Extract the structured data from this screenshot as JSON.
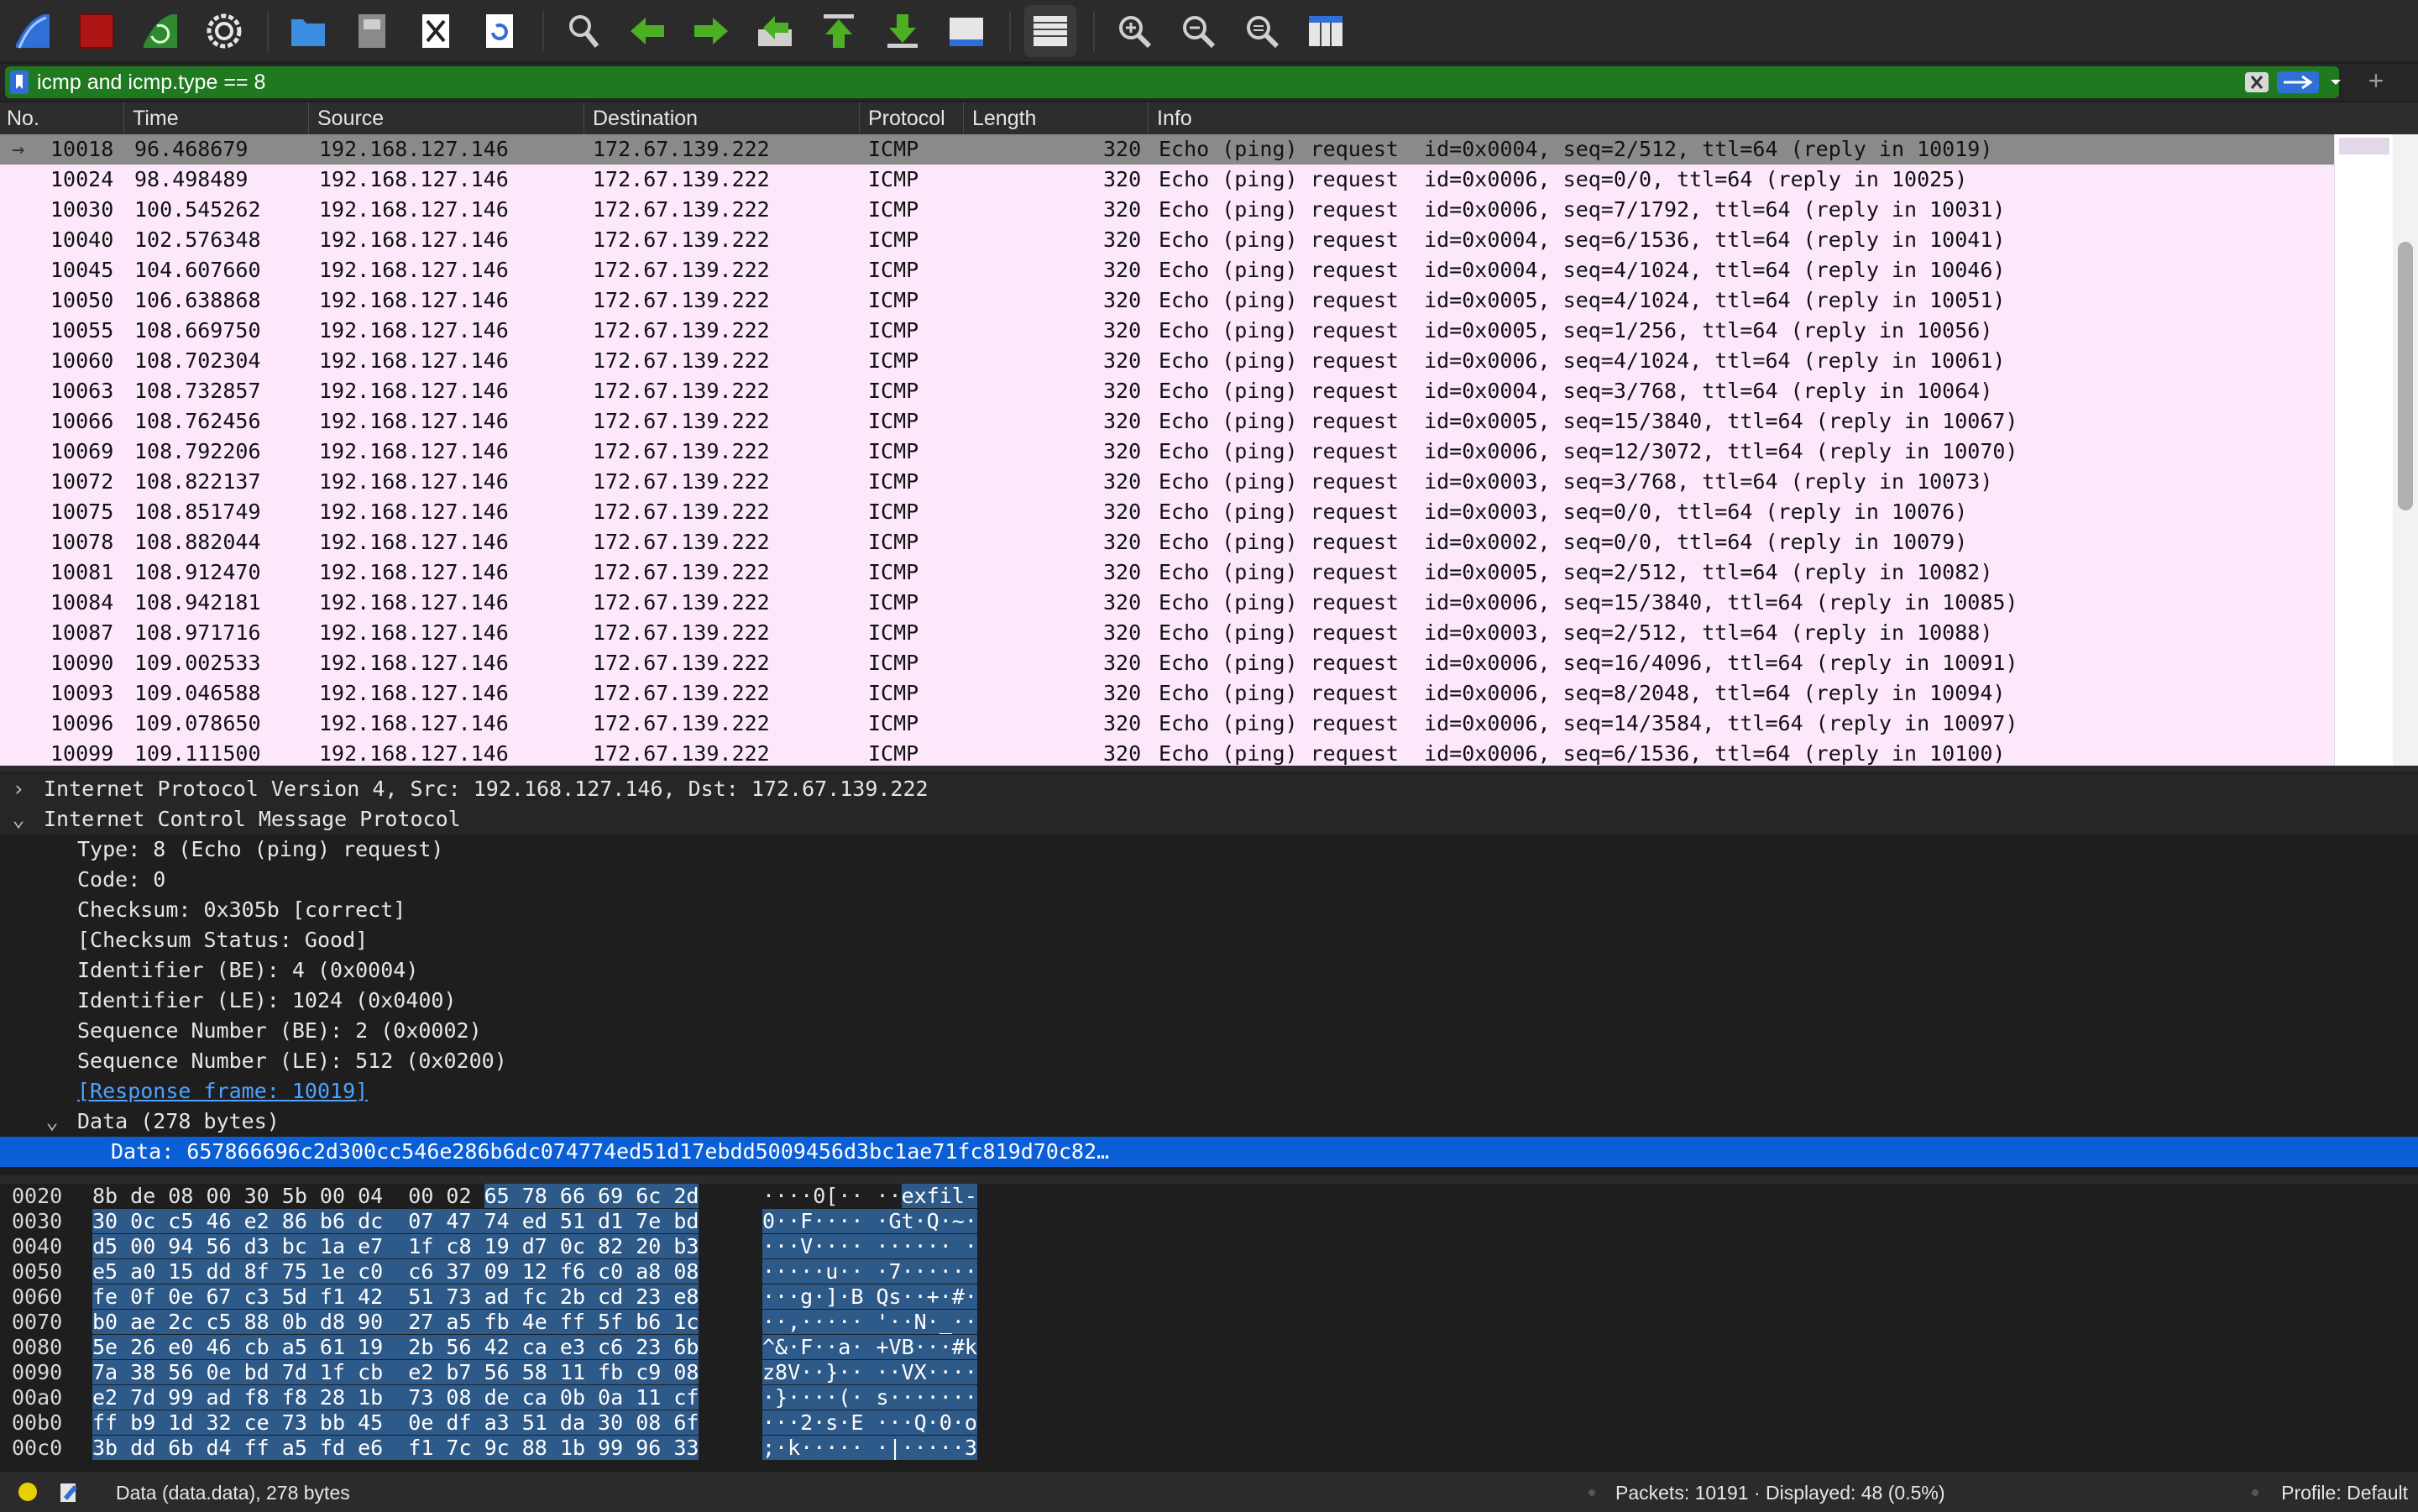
{
  "toolbar": {
    "buttons": [
      {
        "name": "start-capture-icon"
      },
      {
        "name": "stop-capture-icon"
      },
      {
        "name": "restart-capture-icon"
      },
      {
        "name": "capture-options-icon"
      },
      {
        "name": "open-file-icon"
      },
      {
        "name": "save-file-icon"
      },
      {
        "name": "close-file-icon"
      },
      {
        "name": "reload-file-icon"
      },
      {
        "name": "find-packet-icon"
      },
      {
        "name": "go-back-icon"
      },
      {
        "name": "go-forward-icon"
      },
      {
        "name": "go-to-packet-icon"
      },
      {
        "name": "go-first-packet-icon"
      },
      {
        "name": "go-last-packet-icon"
      },
      {
        "name": "autoscroll-icon"
      },
      {
        "name": "colorize-icon"
      },
      {
        "name": "zoom-in-icon"
      },
      {
        "name": "zoom-out-icon"
      },
      {
        "name": "normal-size-icon"
      },
      {
        "name": "resize-columns-icon"
      }
    ]
  },
  "filter": {
    "value": "icmp and icmp.type == 8",
    "color": "#1f7a1f"
  },
  "packet_list": {
    "columns": [
      "No.",
      "Time",
      "Source",
      "Destination",
      "Protocol",
      "Length",
      "Info"
    ],
    "row_color": "#fde8fb",
    "rows": [
      {
        "no": "10018",
        "time": "96.468679",
        "src": "192.168.127.146",
        "dst": "172.67.139.222",
        "proto": "ICMP",
        "len": "320",
        "info": "Echo (ping) request  id=0x0004, seq=2/512, ttl=64 (reply in 10019)",
        "selected": true
      },
      {
        "no": "10024",
        "time": "98.498489",
        "src": "192.168.127.146",
        "dst": "172.67.139.222",
        "proto": "ICMP",
        "len": "320",
        "info": "Echo (ping) request  id=0x0006, seq=0/0, ttl=64 (reply in 10025)"
      },
      {
        "no": "10030",
        "time": "100.545262",
        "src": "192.168.127.146",
        "dst": "172.67.139.222",
        "proto": "ICMP",
        "len": "320",
        "info": "Echo (ping) request  id=0x0006, seq=7/1792, ttl=64 (reply in 10031)"
      },
      {
        "no": "10040",
        "time": "102.576348",
        "src": "192.168.127.146",
        "dst": "172.67.139.222",
        "proto": "ICMP",
        "len": "320",
        "info": "Echo (ping) request  id=0x0004, seq=6/1536, ttl=64 (reply in 10041)"
      },
      {
        "no": "10045",
        "time": "104.607660",
        "src": "192.168.127.146",
        "dst": "172.67.139.222",
        "proto": "ICMP",
        "len": "320",
        "info": "Echo (ping) request  id=0x0004, seq=4/1024, ttl=64 (reply in 10046)"
      },
      {
        "no": "10050",
        "time": "106.638868",
        "src": "192.168.127.146",
        "dst": "172.67.139.222",
        "proto": "ICMP",
        "len": "320",
        "info": "Echo (ping) request  id=0x0005, seq=4/1024, ttl=64 (reply in 10051)"
      },
      {
        "no": "10055",
        "time": "108.669750",
        "src": "192.168.127.146",
        "dst": "172.67.139.222",
        "proto": "ICMP",
        "len": "320",
        "info": "Echo (ping) request  id=0x0005, seq=1/256, ttl=64 (reply in 10056)"
      },
      {
        "no": "10060",
        "time": "108.702304",
        "src": "192.168.127.146",
        "dst": "172.67.139.222",
        "proto": "ICMP",
        "len": "320",
        "info": "Echo (ping) request  id=0x0006, seq=4/1024, ttl=64 (reply in 10061)"
      },
      {
        "no": "10063",
        "time": "108.732857",
        "src": "192.168.127.146",
        "dst": "172.67.139.222",
        "proto": "ICMP",
        "len": "320",
        "info": "Echo (ping) request  id=0x0004, seq=3/768, ttl=64 (reply in 10064)"
      },
      {
        "no": "10066",
        "time": "108.762456",
        "src": "192.168.127.146",
        "dst": "172.67.139.222",
        "proto": "ICMP",
        "len": "320",
        "info": "Echo (ping) request  id=0x0005, seq=15/3840, ttl=64 (reply in 10067)"
      },
      {
        "no": "10069",
        "time": "108.792206",
        "src": "192.168.127.146",
        "dst": "172.67.139.222",
        "proto": "ICMP",
        "len": "320",
        "info": "Echo (ping) request  id=0x0006, seq=12/3072, ttl=64 (reply in 10070)"
      },
      {
        "no": "10072",
        "time": "108.822137",
        "src": "192.168.127.146",
        "dst": "172.67.139.222",
        "proto": "ICMP",
        "len": "320",
        "info": "Echo (ping) request  id=0x0003, seq=3/768, ttl=64 (reply in 10073)"
      },
      {
        "no": "10075",
        "time": "108.851749",
        "src": "192.168.127.146",
        "dst": "172.67.139.222",
        "proto": "ICMP",
        "len": "320",
        "info": "Echo (ping) request  id=0x0003, seq=0/0, ttl=64 (reply in 10076)"
      },
      {
        "no": "10078",
        "time": "108.882044",
        "src": "192.168.127.146",
        "dst": "172.67.139.222",
        "proto": "ICMP",
        "len": "320",
        "info": "Echo (ping) request  id=0x0002, seq=0/0, ttl=64 (reply in 10079)"
      },
      {
        "no": "10081",
        "time": "108.912470",
        "src": "192.168.127.146",
        "dst": "172.67.139.222",
        "proto": "ICMP",
        "len": "320",
        "info": "Echo (ping) request  id=0x0005, seq=2/512, ttl=64 (reply in 10082)"
      },
      {
        "no": "10084",
        "time": "108.942181",
        "src": "192.168.127.146",
        "dst": "172.67.139.222",
        "proto": "ICMP",
        "len": "320",
        "info": "Echo (ping) request  id=0x0006, seq=15/3840, ttl=64 (reply in 10085)"
      },
      {
        "no": "10087",
        "time": "108.971716",
        "src": "192.168.127.146",
        "dst": "172.67.139.222",
        "proto": "ICMP",
        "len": "320",
        "info": "Echo (ping) request  id=0x0003, seq=2/512, ttl=64 (reply in 10088)"
      },
      {
        "no": "10090",
        "time": "109.002533",
        "src": "192.168.127.146",
        "dst": "172.67.139.222",
        "proto": "ICMP",
        "len": "320",
        "info": "Echo (ping) request  id=0x0006, seq=16/4096, ttl=64 (reply in 10091)"
      },
      {
        "no": "10093",
        "time": "109.046588",
        "src": "192.168.127.146",
        "dst": "172.67.139.222",
        "proto": "ICMP",
        "len": "320",
        "info": "Echo (ping) request  id=0x0006, seq=8/2048, ttl=64 (reply in 10094)"
      },
      {
        "no": "10096",
        "time": "109.078650",
        "src": "192.168.127.146",
        "dst": "172.67.139.222",
        "proto": "ICMP",
        "len": "320",
        "info": "Echo (ping) request  id=0x0006, seq=14/3584, ttl=64 (reply in 10097)"
      },
      {
        "no": "10099",
        "time": "109.111500",
        "src": "192.168.127.146",
        "dst": "172.67.139.222",
        "proto": "ICMP",
        "len": "320",
        "info": "Echo (ping) request  id=0x0006, seq=6/1536, ttl=64 (reply in 10100)"
      }
    ]
  },
  "details": {
    "rows": [
      {
        "arrow": "›",
        "text": "Internet Protocol Version 4, Src: 192.168.127.146, Dst: 172.67.139.222",
        "indent": 0
      },
      {
        "arrow": "⌄",
        "text": "Internet Control Message Protocol",
        "indent": 0
      },
      {
        "arrow": "",
        "text": "Type: 8 (Echo (ping) request)",
        "indent": 1
      },
      {
        "arrow": "",
        "text": "Code: 0",
        "indent": 1
      },
      {
        "arrow": "",
        "text": "Checksum: 0x305b [correct]",
        "indent": 1
      },
      {
        "arrow": "",
        "text": "[Checksum Status: Good]",
        "indent": 1
      },
      {
        "arrow": "",
        "text": "Identifier (BE): 4 (0x0004)",
        "indent": 1
      },
      {
        "arrow": "",
        "text": "Identifier (LE): 1024 (0x0400)",
        "indent": 1
      },
      {
        "arrow": "",
        "text": "Sequence Number (BE): 2 (0x0002)",
        "indent": 1
      },
      {
        "arrow": "",
        "text": "Sequence Number (LE): 512 (0x0200)",
        "indent": 1
      },
      {
        "arrow": "",
        "text": "[Response frame: 10019]",
        "indent": 1,
        "link": true
      },
      {
        "arrow": "⌄",
        "text": "Data (278 bytes)",
        "indent": 1
      },
      {
        "arrow": "",
        "text": "Data: 657866696c2d300cc546e286b6dc074774ed51d17ebdd5009456d3bc1ae71fc819d70c82…",
        "indent": 2,
        "selected": true
      }
    ]
  },
  "hex": {
    "lines": [
      {
        "offset": "0020",
        "plain_bytes": "8b de 08 00 30 5b 00 04  00 02 ",
        "hl_bytes": "65 78 66 69 6c 2d",
        "plain_ascii": "····0[·· ··",
        "hl_ascii": "exfil-"
      },
      {
        "offset": "0030",
        "plain_bytes": "",
        "hl_bytes": "30 0c c5 46 e2 86 b6 dc  07 47 74 ed 51 d1 7e bd",
        "plain_ascii": "",
        "hl_ascii": "0··F···· ·Gt·Q·~·"
      },
      {
        "offset": "0040",
        "plain_bytes": "",
        "hl_bytes": "d5 00 94 56 d3 bc 1a e7  1f c8 19 d7 0c 82 20 b3",
        "plain_ascii": "",
        "hl_ascii": "···V···· ······ ·"
      },
      {
        "offset": "0050",
        "plain_bytes": "",
        "hl_bytes": "e5 a0 15 dd 8f 75 1e c0  c6 37 09 12 f6 c0 a8 08",
        "plain_ascii": "",
        "hl_ascii": "·····u·· ·7······"
      },
      {
        "offset": "0060",
        "plain_bytes": "",
        "hl_bytes": "fe 0f 0e 67 c3 5d f1 42  51 73 ad fc 2b cd 23 e8",
        "plain_ascii": "",
        "hl_ascii": "···g·]·B Qs··+·#·"
      },
      {
        "offset": "0070",
        "plain_bytes": "",
        "hl_bytes": "b0 ae 2c c5 88 0b d8 90  27 a5 fb 4e ff 5f b6 1c",
        "plain_ascii": "",
        "hl_ascii": "··,····· '··N·_··"
      },
      {
        "offset": "0080",
        "plain_bytes": "",
        "hl_bytes": "5e 26 e0 46 cb a5 61 19  2b 56 42 ca e3 c6 23 6b",
        "plain_ascii": "",
        "hl_ascii": "^&·F··a· +VB···#k"
      },
      {
        "offset": "0090",
        "plain_bytes": "",
        "hl_bytes": "7a 38 56 0e bd 7d 1f cb  e2 b7 56 58 11 fb c9 08",
        "plain_ascii": "",
        "hl_ascii": "z8V··}·· ··VX····"
      },
      {
        "offset": "00a0",
        "plain_bytes": "",
        "hl_bytes": "e2 7d 99 ad f8 f8 28 1b  73 08 de ca 0b 0a 11 cf",
        "plain_ascii": "",
        "hl_ascii": "·}····(· s·······"
      },
      {
        "offset": "00b0",
        "plain_bytes": "",
        "hl_bytes": "ff b9 1d 32 ce 73 bb 45  0e df a3 51 da 30 08 6f",
        "plain_ascii": "",
        "hl_ascii": "···2·s·E ···Q·0·o"
      },
      {
        "offset": "00c0",
        "plain_bytes": "",
        "hl_bytes": "3b dd 6b d4 ff a5 fd e6  f1 7c 9c 88 1b 99 96 33",
        "plain_ascii": "",
        "hl_ascii": ";·k····· ·|·····3"
      }
    ]
  },
  "status": {
    "field_info": "Data (data.data), 278 bytes",
    "packets": "Packets: 10191 · Displayed: 48 (0.5%)",
    "profile": "Profile: Default"
  }
}
